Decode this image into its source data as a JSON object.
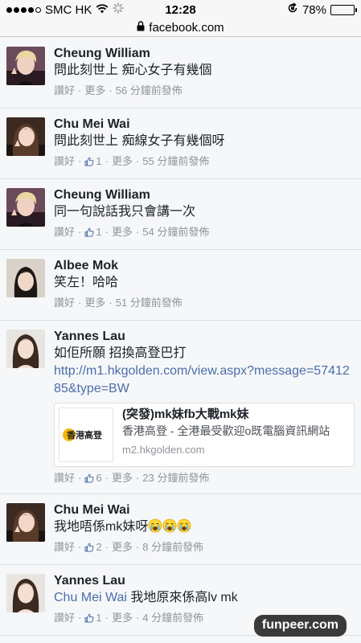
{
  "status_bar": {
    "carrier": "SMC HK",
    "time": "12:28",
    "battery": "78%",
    "battery_level": 0.78
  },
  "url_bar": {
    "url": "facebook.com"
  },
  "actions": {
    "like": "讚好",
    "more": "更多"
  },
  "comments": [
    {
      "author": "Cheung William",
      "text": "問此刻世上 痴心女子有幾個",
      "likes": null,
      "time": "56 分鐘前發佈",
      "avatar": "cheung-william"
    },
    {
      "author": "Chu Mei Wai",
      "text": "問此刻世上 痴線女子有幾個呀",
      "likes": "1",
      "time": "55 分鐘前發佈",
      "avatar": "chu-mei-wai"
    },
    {
      "author": "Cheung William",
      "text": "同一句說話我只會講一次",
      "likes": "1",
      "time": "54 分鐘前發佈",
      "avatar": "cheung-william"
    },
    {
      "author": "Albee Mok",
      "text": "笑左！哈哈",
      "likes": null,
      "time": "51 分鐘前發佈",
      "avatar": "albee-mok"
    },
    {
      "author": "Yannes Lau",
      "text": "如佢所願 招換高登巴打",
      "link": "http://m1.hkgolden.com/view.aspx?message=5741285&type=BW",
      "preview": {
        "title": "(突發)mk妹fb大戰mk妹",
        "desc": "香港高登 - 全港最受歡迎o既電腦資訊網站",
        "domain": "m2.hkgolden.com",
        "logo_text": "香港高登"
      },
      "likes": "6",
      "time": "23 分鐘前發佈",
      "avatar": "yannes-lau"
    },
    {
      "author": "Chu Mei Wai",
      "text": "我地唔係mk妹呀",
      "emoji": "😭😭😭",
      "likes": "2",
      "time": "8 分鐘前發佈",
      "avatar": "chu-mei-wai"
    },
    {
      "author": "Yannes Lau",
      "mention": "Chu Mei Wai",
      "text": " 我地原來係高lv mk",
      "likes": "1",
      "time": "4 分鐘前發佈",
      "avatar": "yannes-lau"
    }
  ],
  "watermark": "funpeer.com",
  "colors": {
    "link": "#4a6ea9",
    "meta": "#90949c",
    "text": "#1d2129",
    "background": "#f6f7f9"
  }
}
